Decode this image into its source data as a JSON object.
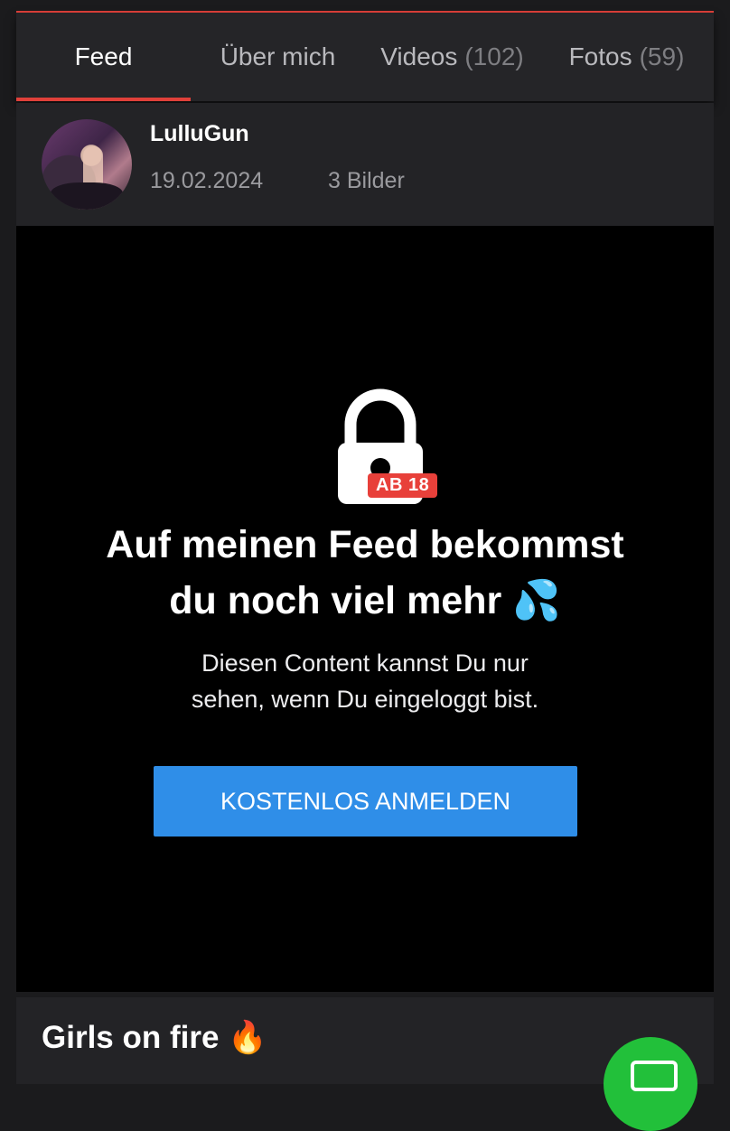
{
  "tabs": [
    {
      "label": "Feed",
      "count": ""
    },
    {
      "label": "Über mich",
      "count": ""
    },
    {
      "label": "Videos",
      "count": "(102)"
    },
    {
      "label": "Fotos",
      "count": "(59)"
    }
  ],
  "post": {
    "username": "LulluGun",
    "date": "19.02.2024",
    "image_count": "3 Bilder"
  },
  "locked": {
    "age_badge": "AB 18",
    "headline_line1": "Auf meinen Feed bekommst",
    "headline_line2": "du noch viel mehr 💦",
    "subtext_line1": "Diesen Content kannst Du nur",
    "subtext_line2": "sehen, wenn Du eingeloggt bist.",
    "cta_label": "KOSTENLOS ANMELDEN"
  },
  "next_post": {
    "title": "Girls on fire 🔥"
  },
  "colors": {
    "accent": "#e0403a",
    "cta": "#2f8ee8",
    "fab": "#22c03a"
  }
}
